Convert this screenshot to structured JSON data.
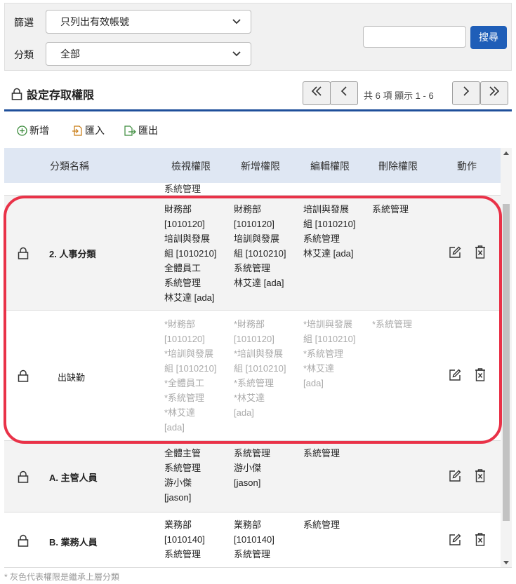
{
  "filter": {
    "filter_label": "篩選",
    "filter_value": "只列出有效帳號",
    "category_label": "分類",
    "category_value": "全部",
    "search_value": "",
    "search_button": "搜尋"
  },
  "section": {
    "title": "設定存取權限",
    "pager_first": "«",
    "pager_prev": "‹",
    "pager_info": "共 6 項 顯示 1 - 6",
    "pager_next": "›",
    "pager_last": "»"
  },
  "toolbar": {
    "add": "新增",
    "import": "匯入",
    "export": "匯出"
  },
  "grid": {
    "headers": {
      "name": "分類名稱",
      "view": "檢視權限",
      "add": "新增權限",
      "edit": "編輯權限",
      "delete": "刪除權限",
      "action": "動作"
    },
    "rows": [
      {
        "name": "2. 人事分類",
        "view": "財務部\n[1010120]\n培訓與發展\n組 [1010210]\n全體員工\n系統管理\n林艾達 [ada]",
        "add": "財務部\n[1010120]\n培訓與發展\n組 [1010210]\n系統管理\n林艾達 [ada]",
        "edit": "培訓與發展\n組 [1010210]\n系統管理\n林艾達 [ada]",
        "delete": "系統管理"
      },
      {
        "name": "出缺勤",
        "view": "*財務部\n[1010120]\n*培訓與發展\n組 [1010210]\n*全體員工\n*系統管理\n*林艾達\n[ada]",
        "add": "*財務部\n[1010120]\n*培訓與發展\n組 [1010210]\n*系統管理\n*林艾達\n[ada]",
        "edit": "*培訓與發展\n組 [1010210]\n*系統管理\n*林艾達\n[ada]",
        "delete": "*系統管理"
      },
      {
        "name": "A. 主管人員",
        "view": "全體主管\n系統管理\n游小傑\n[jason]",
        "add": "系統管理\n游小傑\n[jason]",
        "edit": "系統管理",
        "delete": ""
      },
      {
        "name": "B. 業務人員",
        "view": "業務部\n[1010140]\n系統管理",
        "add": "業務部\n[1010140]\n系統管理",
        "edit": "系統管理",
        "delete": ""
      }
    ],
    "cut_row_text": "系統管理"
  },
  "footnote": "* 灰色代表權限是繼承上層分類",
  "colors": {
    "accent": "#1f5eb8",
    "highlight": "#e93248",
    "header_bg": "#dfe7f3",
    "inherited_text": "#aaaaaa"
  }
}
